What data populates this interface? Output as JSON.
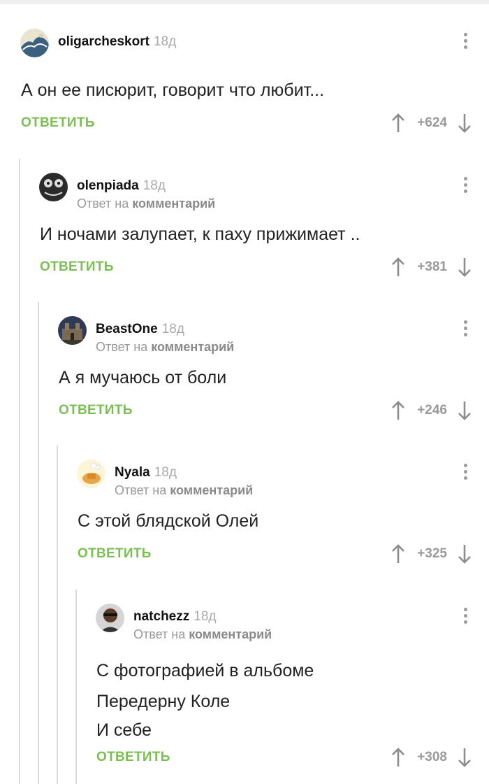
{
  "reply_label": "ОТВЕТИТЬ",
  "reply_prefix": "Ответ на",
  "reply_target": "комментарий",
  "comments": [
    {
      "user": "oligarcheskort",
      "time": "18д",
      "lines": [
        "А он ее писюрит, говорит что любит..."
      ],
      "score": "+624"
    },
    {
      "user": "olenpiada",
      "time": "18д",
      "lines": [
        "И ночами залупает, к паху прижимает .."
      ],
      "score": "+381"
    },
    {
      "user": "BeastOne",
      "time": "18д",
      "lines": [
        "А я мучаюсь от боли"
      ],
      "score": "+246"
    },
    {
      "user": "Nyala",
      "time": "18д",
      "lines": [
        "С этой блядской Олей"
      ],
      "score": "+325"
    },
    {
      "user": "natchezz",
      "time": "18д",
      "lines": [
        "С фотографией в альбоме",
        "Передерну Коле",
        "И себе"
      ],
      "score": "+308"
    }
  ],
  "colors": {
    "accent": "#7bbf53",
    "muted": "#999999",
    "thread_line": "#dcdcdc"
  }
}
